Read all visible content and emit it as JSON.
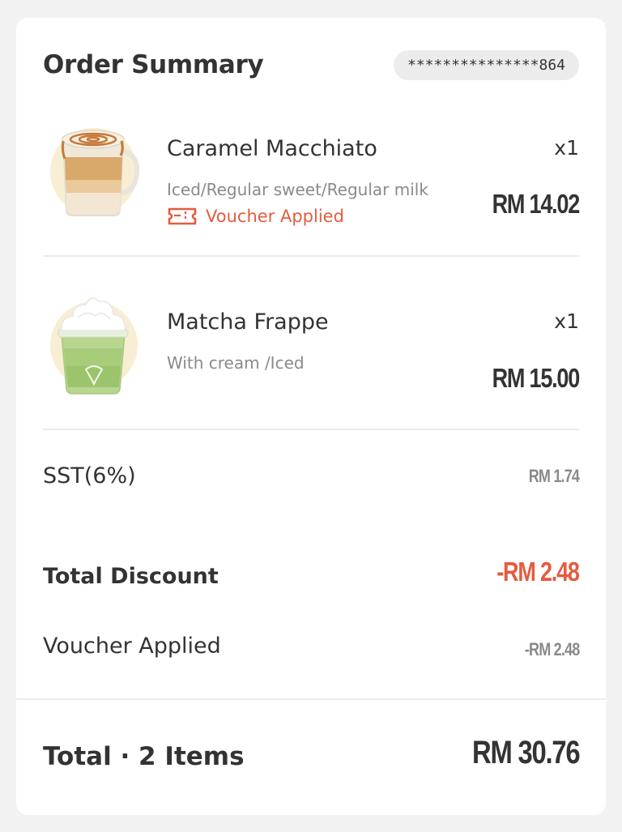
{
  "summary": {
    "title": "Order Summary",
    "order_number": "***************864"
  },
  "items": [
    {
      "name": "Caramel Macchiato",
      "options": "Iced/Regular sweet/Regular milk",
      "quantity": "x1",
      "price": "RM 14.02",
      "voucher_label": "Voucher Applied",
      "image_icon": "caramel-macchiato-cup"
    },
    {
      "name": "Matcha Frappe",
      "options": "With cream /Iced",
      "quantity": "x1",
      "price": "RM 15.00",
      "image_icon": "matcha-frappe-cup"
    }
  ],
  "charges": {
    "sst_label": "SST(6%)",
    "sst_value": "RM 1.74",
    "discount_label": "Total Discount",
    "discount_value": "-RM 2.48",
    "voucher_label": "Voucher Applied",
    "voucher_value": "-RM 2.48"
  },
  "total": {
    "label": "Total · 2 Items",
    "value": "RM 30.76"
  },
  "colors": {
    "accent": "#e45c3f",
    "text": "#333333",
    "muted": "#8a8a8a",
    "background": "#f2f2f2",
    "card": "#ffffff"
  }
}
